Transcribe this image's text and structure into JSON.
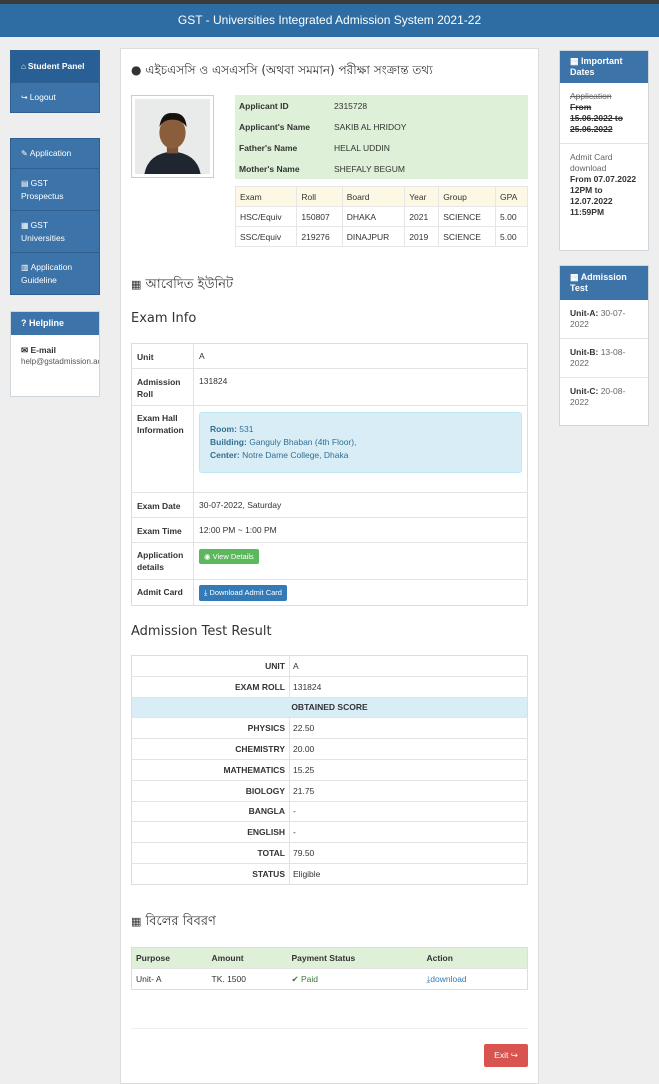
{
  "header": {
    "title": "GST - Universities Integrated Admission System 2021-22"
  },
  "left": {
    "panel1": [
      {
        "icon": "home-icon",
        "glyph": "⌂",
        "label": "Student Panel"
      },
      {
        "icon": "logout-icon",
        "glyph": "↪",
        "label": "Logout"
      }
    ],
    "panel2": [
      {
        "icon": "edit-icon",
        "glyph": "✎",
        "label": "Application"
      },
      {
        "icon": "file-icon",
        "glyph": "▤",
        "label": "GST Prospectus"
      },
      {
        "icon": "building-icon",
        "glyph": "▦",
        "label": "GST Universities"
      },
      {
        "icon": "book-icon",
        "glyph": "▥",
        "label": "Application Guideline"
      }
    ],
    "helpline": {
      "title": "Helpline",
      "email_label": "E-mail",
      "email": "help@gstadmission.ac.bd"
    }
  },
  "right": {
    "important_dates": {
      "title": "Important Dates",
      "application_label": "Application",
      "application_from": "From",
      "application_dates": "15.06.2022 to 25.06.2022",
      "admit_label": "Admit Card download",
      "admit_dates": "From 07.07.2022 12PM to 12.07.2022 11:59PM"
    },
    "admission_test": {
      "title": "Admission Test",
      "items": [
        {
          "unit": "Unit-A:",
          "date": "30-07-2022"
        },
        {
          "unit": "Unit-B:",
          "date": "13-08-2022"
        },
        {
          "unit": "Unit-C:",
          "date": "20-08-2022"
        }
      ]
    }
  },
  "main": {
    "title": "এইচএসসি ও এসএসসি (অথবা সমমান) পরীক্ষা সংক্রান্ত তথ্য",
    "applicant": {
      "id_label": "Applicant ID",
      "id": "2315728",
      "name_label": "Applicant's Name",
      "name": "SAKIB AL HRIDOY",
      "father_label": "Father's Name",
      "father": "HELAL UDDIN",
      "mother_label": "Mother's Name",
      "mother": "SHEFALY BEGUM"
    },
    "exams": {
      "headers": [
        "Exam",
        "Roll",
        "Board",
        "Year",
        "Group",
        "GPA"
      ],
      "rows": [
        [
          "HSC/Equiv",
          "150807",
          "DHAKA",
          "2021",
          "SCIENCE",
          "5.00"
        ],
        [
          "SSC/Equiv",
          "219276",
          "DINAJPUR",
          "2019",
          "SCIENCE",
          "5.00"
        ]
      ]
    },
    "units_title": "আবেদিত ইউনিট",
    "exam_info": {
      "title": "Exam Info",
      "unit_label": "Unit",
      "unit": "A",
      "roll_label": "Admission Roll",
      "roll": "131824",
      "hall_label": "Exam Hall Information",
      "room_label": "Room:",
      "room": "531",
      "building_label": "Building:",
      "building": "Ganguly Bhaban (4th Floor),",
      "center_label": "Center:",
      "center": "Notre Dame College, Dhaka",
      "date_label": "Exam Date",
      "date": "30-07-2022, Saturday",
      "time_label": "Exam Time",
      "time": "12:00 PM ~ 1:00 PM",
      "app_details_label": "Application details",
      "view_details": "View Details",
      "admit_label": "Admit Card",
      "download_admit": "Download Admit Card"
    },
    "result": {
      "title": "Admission Test Result",
      "unit_label": "UNIT",
      "unit": "A",
      "roll_label": "EXAM ROLL",
      "roll": "131824",
      "obtained": "OBTAINED SCORE",
      "subjects": [
        {
          "name": "PHYSICS",
          "score": "22.50"
        },
        {
          "name": "CHEMISTRY",
          "score": "20.00"
        },
        {
          "name": "MATHEMATICS",
          "score": "15.25"
        },
        {
          "name": "BIOLOGY",
          "score": "21.75"
        },
        {
          "name": "BANGLA",
          "score": "-"
        },
        {
          "name": "ENGLISH",
          "score": "-"
        }
      ],
      "total_label": "TOTAL",
      "total": "79.50",
      "status_label": "STATUS",
      "status": "Eligible"
    },
    "bill": {
      "title": "বিলের বিবরণ",
      "headers": [
        "Purpose",
        "Amount",
        "Payment Status",
        "Action"
      ],
      "purpose": "Unit- A",
      "amount": "TK. 1500",
      "status": "Paid",
      "action": "download"
    },
    "exit": "Exit"
  }
}
